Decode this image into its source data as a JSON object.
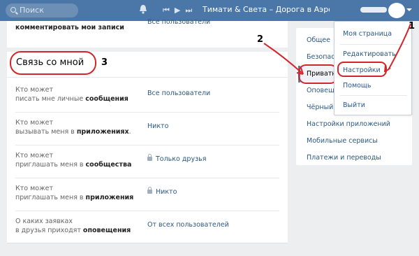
{
  "topbar": {
    "search_placeholder": "Поиск",
    "player_controls": [
      "⏮",
      "▶",
      "⏭"
    ],
    "track": "Тимати & Света – Дорога в Аэроп..."
  },
  "annotations": {
    "one": "1",
    "two": "2",
    "three": "3"
  },
  "main": {
    "prev_row": {
      "label": "комментировать мои записи",
      "value": "Все пользователи"
    },
    "section_title": "Связь со мной",
    "rows": [
      {
        "line1": "Кто может",
        "line2_plain": "писать мне личные ",
        "line2_bold": "сообщения",
        "line2_tail": "",
        "value": "Все пользователи",
        "locked": false
      },
      {
        "line1": "Кто может",
        "line2_plain": "вызывать меня в ",
        "line2_bold": "приложениях",
        "line2_tail": ".",
        "value": "Никто",
        "locked": false
      },
      {
        "line1": "Кто может",
        "line2_plain": "приглашать меня в ",
        "line2_bold": "сообщества",
        "line2_tail": "",
        "value": "Только друзья",
        "locked": true
      },
      {
        "line1": "Кто может",
        "line2_plain": "приглашать меня в ",
        "line2_bold": "приложения",
        "line2_tail": "",
        "value": "Никто",
        "locked": true
      },
      {
        "line1": "О каких заявках",
        "line2_plain": "в друзья приходят ",
        "line2_bold": "оповещения",
        "line2_tail": "",
        "value": "От всех пользователей",
        "locked": false
      }
    ]
  },
  "right_nav": {
    "items": [
      "Общее",
      "Безопасн",
      "Приватн",
      "Оповеще",
      "Чёрный с",
      "Настройки приложений",
      "Мобильные сервисы",
      "Платежи и переводы"
    ]
  },
  "dropdown": {
    "items": [
      "Моя страница",
      "Редактировать",
      "Настройки",
      "Помощь",
      "Выйти"
    ]
  },
  "colors": {
    "header": "#4a76a8",
    "link": "#2a5885",
    "annotation": "#d3262b"
  }
}
